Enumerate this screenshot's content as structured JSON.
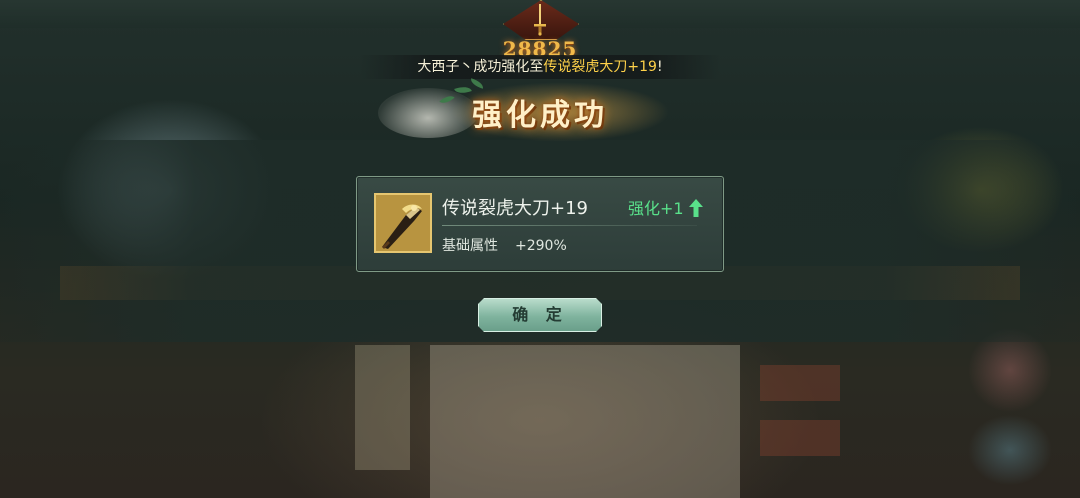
{
  "power": {
    "value": "28825"
  },
  "notice": {
    "player": "大西子丶",
    "text_middle": "成功强化至",
    "item": "传说裂虎大刀+19",
    "suffix": "!"
  },
  "dialog": {
    "title": "强化成功",
    "item": {
      "name": "传说裂虎大刀+19",
      "enhance": "强化+1",
      "attr_label": "基础属性",
      "attr_value": "+290%"
    },
    "confirm_label": "确 定"
  },
  "colors": {
    "accent_gold": "#f0b94a",
    "enhance_green": "#59e08a",
    "notice_highlight": "#ffd24a",
    "button_green": "#7fb39e"
  },
  "icons": {
    "item": "saber-weapon-icon",
    "power": "sword-emblem-icon",
    "enhance": "up-arrow-icon"
  }
}
